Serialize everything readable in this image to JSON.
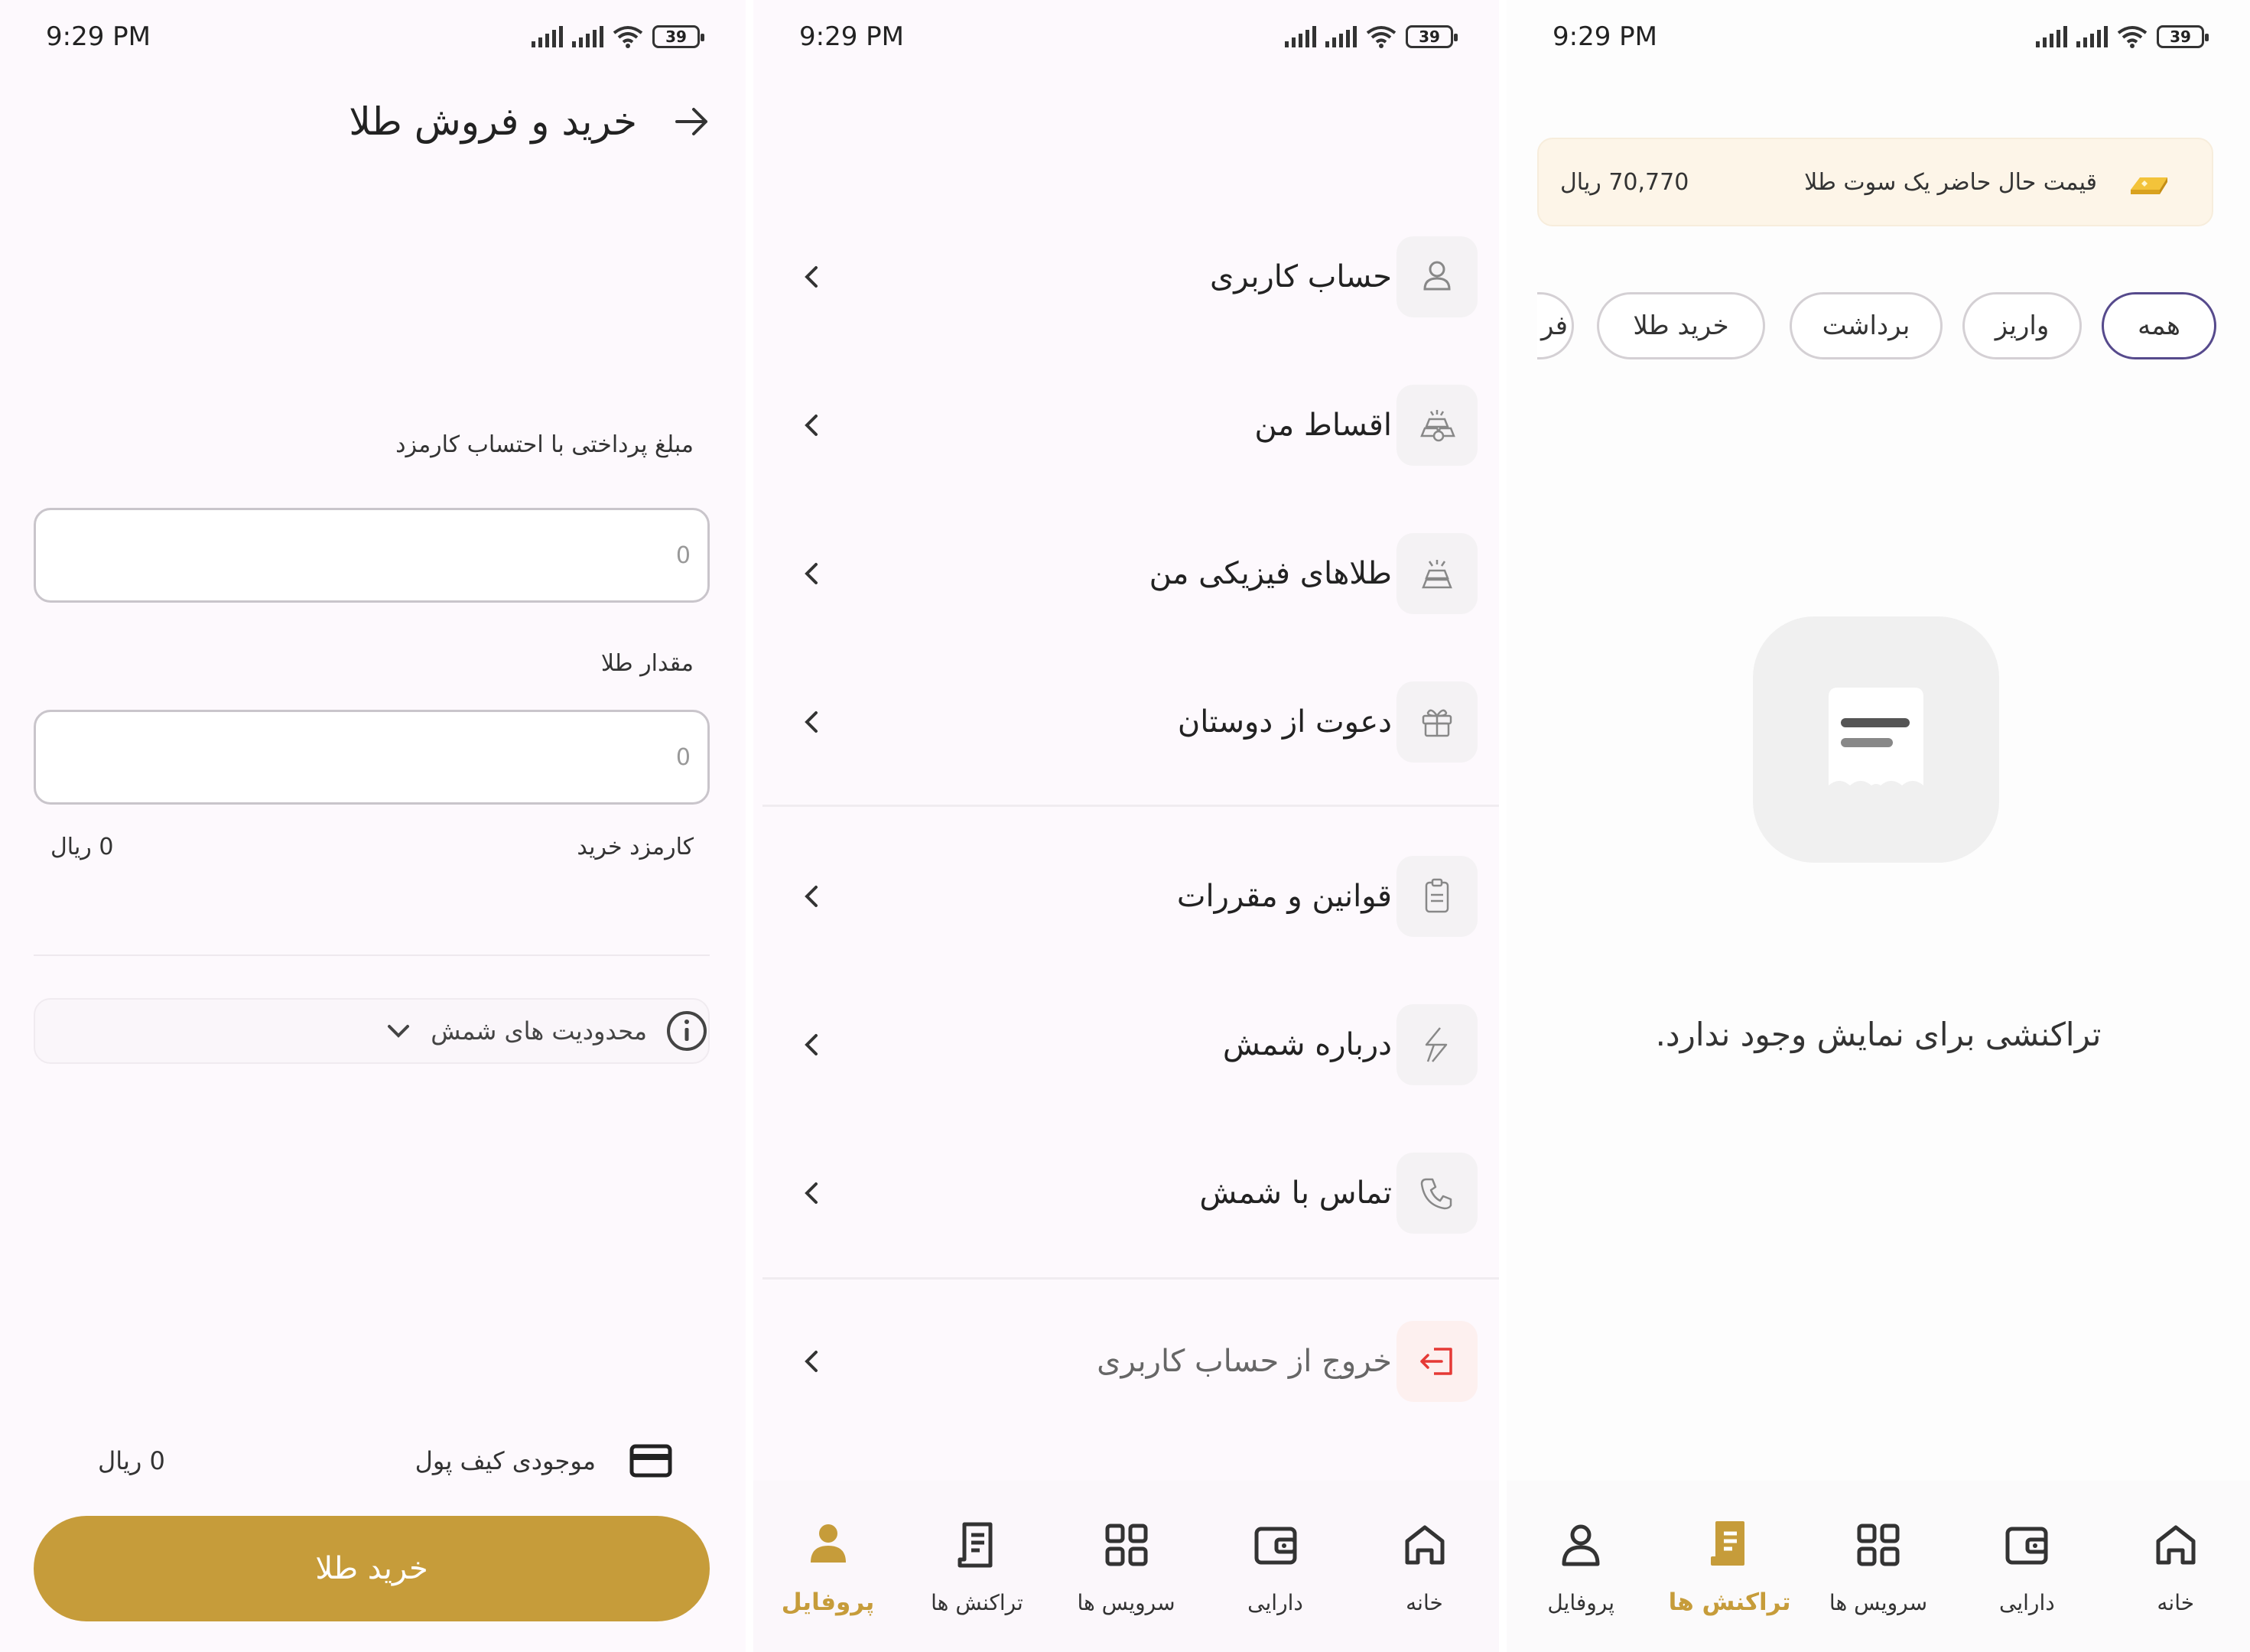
{
  "status_bar": {
    "time": "9:29 PM",
    "battery": "39"
  },
  "buy_sell_screen": {
    "title": "خرید و فروش طلا",
    "payment_label": "مبلغ پرداختی با احتساب کارمزد",
    "payment_placeholder": "0",
    "gold_amount_label": "مقدار طلا",
    "gold_amount_placeholder": "0",
    "fee_label": "کارمزد خرید",
    "fee_value": "0 ریال",
    "limits_label": "محدودیت های شمش",
    "wallet_label": "موجودی کیف پول",
    "wallet_value": "0 ریال",
    "buy_button": "خرید طلا"
  },
  "profile_screen": {
    "menu": [
      {
        "label": "حساب کاربری",
        "icon": "user-icon"
      },
      {
        "label": "اقساط من",
        "icon": "installments-icon"
      },
      {
        "label": "طلاهای فیزیکی من",
        "icon": "physical-gold-icon"
      },
      {
        "label": "دعوت از دوستان",
        "icon": "gift-icon"
      },
      {
        "label": "قوانین و مقررات",
        "icon": "clipboard-icon"
      },
      {
        "label": "درباره شمش",
        "icon": "shemsh-logo-icon"
      },
      {
        "label": "تماس با شمش",
        "icon": "phone-icon"
      },
      {
        "label": "خروج از حساب کاربری",
        "icon": "logout-icon"
      }
    ]
  },
  "transactions_screen": {
    "price_label": "قیمت حال حاضر یک سوت طلا",
    "price_value": "70,770 ریال",
    "filters": [
      "همه",
      "واریز",
      "برداشت",
      "خرید طلا",
      "فر"
    ],
    "active_filter": "همه",
    "empty_text": "تراکنشی برای نمایش وجود ندارد."
  },
  "bottom_nav": {
    "items": [
      "خانه",
      "دارایی",
      "سرویس ها",
      "تراکنش ها",
      "پروفایل"
    ]
  },
  "colors": {
    "accent_gold": "#c69c3a",
    "chip_active_border": "#564a8c",
    "logout_red": "#e53935"
  }
}
